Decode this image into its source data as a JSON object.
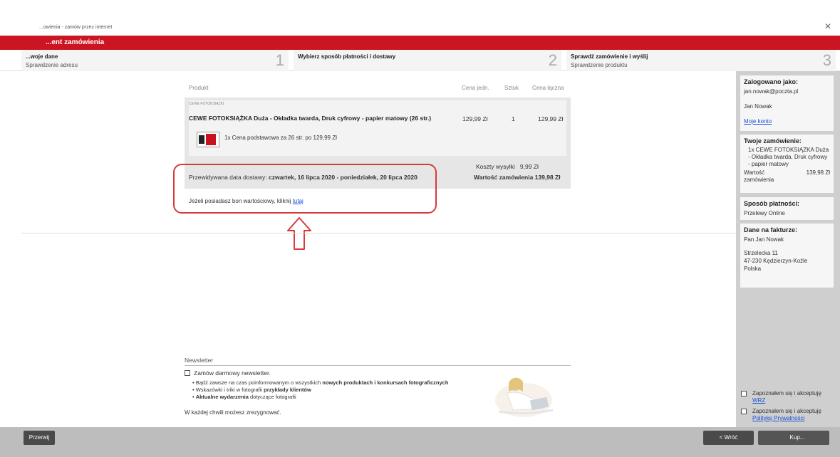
{
  "window": {
    "title": "...owienia - zamów przez internet"
  },
  "header": {
    "label": "...ent zamówienia"
  },
  "steps": [
    {
      "title": "...woje dane",
      "subtitle": "Sprawdzenie adresu",
      "number": "1"
    },
    {
      "title": "Wybierz sposób płatności i dostawy",
      "subtitle": "",
      "number": "2"
    },
    {
      "title": "Sprawdź zamówienie i wyślij",
      "subtitle": "Sprawdzenie produktu",
      "number": "3"
    }
  ],
  "table": {
    "headers": {
      "product": "Produkt",
      "unit_price": "Cena jedn.",
      "qty": "Sztuk",
      "total": "Cena łączna"
    },
    "category": "CEWE FOTOKSIĄŻKI",
    "item": {
      "name": "CEWE FOTOKSIĄŻKA Duża - Okładka twarda, Druk cyfrowy - papier matowy (26 str.)",
      "unit_price": "129,99 Zł",
      "qty": "1",
      "total": "129,99 Zł",
      "detail": "1x Cena podstawowa za 26 str. po 129,99 Zł"
    },
    "shipping": {
      "label": "Koszty wysyłki",
      "value": "9,99 Zł"
    },
    "delivery": {
      "label": "Przewidywana data dostawy:",
      "value": "czwartek, 16 lipca 2020 - poniedziałek, 20 lipca 2020"
    },
    "order_value": {
      "label": "Wartość zamówienia",
      "value": "139,98 Zł"
    },
    "voucher": {
      "text": "Jeżeli posiadasz bon wartościowy, kliknij",
      "link": "tutaj"
    }
  },
  "newsletter": {
    "title": "Newsletter",
    "checkbox_label": "Zamów darmowy newsletter.",
    "bullets": [
      {
        "pre": "Bądź zawsze na czas poinformowanym o wszystkich ",
        "bold": "nowych produktach i konkursach fotograficznych",
        "post": ""
      },
      {
        "pre": "Wskazówki i triki w fotografii ",
        "bold": "przykłady klientów",
        "post": ""
      },
      {
        "pre": "",
        "bold": "Aktualne wydarzenia",
        "post": " dotyczące fotografii"
      }
    ],
    "footnote": "W każdej chwili możesz zrezygnować."
  },
  "sidebar": {
    "logged_in": {
      "heading": "Zalogowano jako:",
      "email": "jan.nowak@poczta.pl",
      "name": "Jan Nowak",
      "account_link": "Moje konto"
    },
    "order": {
      "heading": "Twoje zamówienie:",
      "line": "1x CEWE FOTOKSIĄŻKA Duża - Okładka twarda, Druk cyfrowy - papier matowy",
      "value_label": "Wartość zamówienia",
      "value": "139,98 Zł"
    },
    "payment": {
      "heading": "Sposób płatności:",
      "method": "Przelewy Online"
    },
    "invoice": {
      "heading": "Dane na fakturze:",
      "name": "Pan Jan Nowak",
      "street": "Strzelecka 11",
      "city": "47-230 Kędzierzyn-Koźle",
      "country": "Polska"
    }
  },
  "accept": {
    "terms_text": "Zapoznałem się i akceptuję",
    "terms_link": "WRZ",
    "privacy_text": "Zapoznałem się i akceptuję",
    "privacy_link": "Politykę Prywatności"
  },
  "buttons": {
    "cancel": "Przerwij",
    "back": "< Wróć",
    "next": "Kup..."
  },
  "colors": {
    "brand_red": "#cc1522",
    "highlight": "#d83a3a",
    "link": "#1a4fd6"
  }
}
